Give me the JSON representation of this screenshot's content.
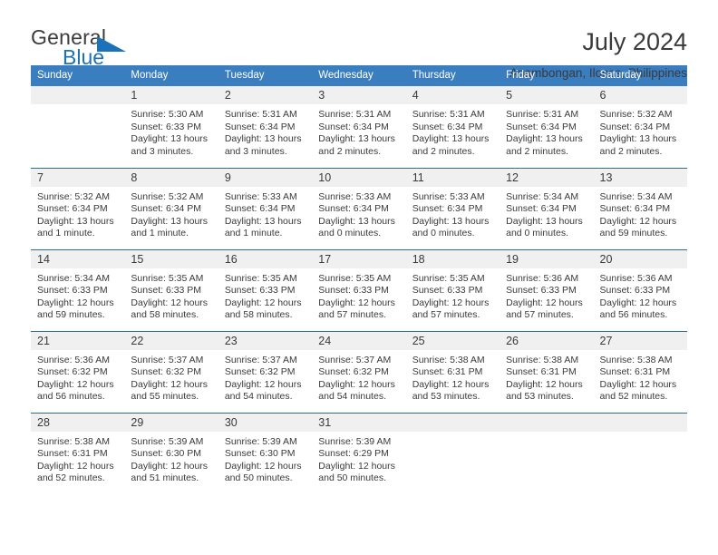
{
  "brand": {
    "name_top": "General",
    "name_bottom": "Blue",
    "triangle_color": "#1b72b8"
  },
  "header": {
    "title": "July 2024",
    "subtitle": "Anambongan, Ilocos, Philippines"
  },
  "theme": {
    "header_bg": "#3a7ec0",
    "row_divider": "#2e6da4",
    "daynum_bg": "#f0f0f0",
    "text": "#3a3a3a"
  },
  "weekdays": [
    "Sunday",
    "Monday",
    "Tuesday",
    "Wednesday",
    "Thursday",
    "Friday",
    "Saturday"
  ],
  "weeks": [
    [
      {
        "day": "",
        "sunrise": "",
        "sunset": "",
        "daylight": ""
      },
      {
        "day": "1",
        "sunrise": "Sunrise: 5:30 AM",
        "sunset": "Sunset: 6:33 PM",
        "daylight": "Daylight: 13 hours and 3 minutes."
      },
      {
        "day": "2",
        "sunrise": "Sunrise: 5:31 AM",
        "sunset": "Sunset: 6:34 PM",
        "daylight": "Daylight: 13 hours and 3 minutes."
      },
      {
        "day": "3",
        "sunrise": "Sunrise: 5:31 AM",
        "sunset": "Sunset: 6:34 PM",
        "daylight": "Daylight: 13 hours and 2 minutes."
      },
      {
        "day": "4",
        "sunrise": "Sunrise: 5:31 AM",
        "sunset": "Sunset: 6:34 PM",
        "daylight": "Daylight: 13 hours and 2 minutes."
      },
      {
        "day": "5",
        "sunrise": "Sunrise: 5:31 AM",
        "sunset": "Sunset: 6:34 PM",
        "daylight": "Daylight: 13 hours and 2 minutes."
      },
      {
        "day": "6",
        "sunrise": "Sunrise: 5:32 AM",
        "sunset": "Sunset: 6:34 PM",
        "daylight": "Daylight: 13 hours and 2 minutes."
      }
    ],
    [
      {
        "day": "7",
        "sunrise": "Sunrise: 5:32 AM",
        "sunset": "Sunset: 6:34 PM",
        "daylight": "Daylight: 13 hours and 1 minute."
      },
      {
        "day": "8",
        "sunrise": "Sunrise: 5:32 AM",
        "sunset": "Sunset: 6:34 PM",
        "daylight": "Daylight: 13 hours and 1 minute."
      },
      {
        "day": "9",
        "sunrise": "Sunrise: 5:33 AM",
        "sunset": "Sunset: 6:34 PM",
        "daylight": "Daylight: 13 hours and 1 minute."
      },
      {
        "day": "10",
        "sunrise": "Sunrise: 5:33 AM",
        "sunset": "Sunset: 6:34 PM",
        "daylight": "Daylight: 13 hours and 0 minutes."
      },
      {
        "day": "11",
        "sunrise": "Sunrise: 5:33 AM",
        "sunset": "Sunset: 6:34 PM",
        "daylight": "Daylight: 13 hours and 0 minutes."
      },
      {
        "day": "12",
        "sunrise": "Sunrise: 5:34 AM",
        "sunset": "Sunset: 6:34 PM",
        "daylight": "Daylight: 13 hours and 0 minutes."
      },
      {
        "day": "13",
        "sunrise": "Sunrise: 5:34 AM",
        "sunset": "Sunset: 6:34 PM",
        "daylight": "Daylight: 12 hours and 59 minutes."
      }
    ],
    [
      {
        "day": "14",
        "sunrise": "Sunrise: 5:34 AM",
        "sunset": "Sunset: 6:33 PM",
        "daylight": "Daylight: 12 hours and 59 minutes."
      },
      {
        "day": "15",
        "sunrise": "Sunrise: 5:35 AM",
        "sunset": "Sunset: 6:33 PM",
        "daylight": "Daylight: 12 hours and 58 minutes."
      },
      {
        "day": "16",
        "sunrise": "Sunrise: 5:35 AM",
        "sunset": "Sunset: 6:33 PM",
        "daylight": "Daylight: 12 hours and 58 minutes."
      },
      {
        "day": "17",
        "sunrise": "Sunrise: 5:35 AM",
        "sunset": "Sunset: 6:33 PM",
        "daylight": "Daylight: 12 hours and 57 minutes."
      },
      {
        "day": "18",
        "sunrise": "Sunrise: 5:35 AM",
        "sunset": "Sunset: 6:33 PM",
        "daylight": "Daylight: 12 hours and 57 minutes."
      },
      {
        "day": "19",
        "sunrise": "Sunrise: 5:36 AM",
        "sunset": "Sunset: 6:33 PM",
        "daylight": "Daylight: 12 hours and 57 minutes."
      },
      {
        "day": "20",
        "sunrise": "Sunrise: 5:36 AM",
        "sunset": "Sunset: 6:33 PM",
        "daylight": "Daylight: 12 hours and 56 minutes."
      }
    ],
    [
      {
        "day": "21",
        "sunrise": "Sunrise: 5:36 AM",
        "sunset": "Sunset: 6:32 PM",
        "daylight": "Daylight: 12 hours and 56 minutes."
      },
      {
        "day": "22",
        "sunrise": "Sunrise: 5:37 AM",
        "sunset": "Sunset: 6:32 PM",
        "daylight": "Daylight: 12 hours and 55 minutes."
      },
      {
        "day": "23",
        "sunrise": "Sunrise: 5:37 AM",
        "sunset": "Sunset: 6:32 PM",
        "daylight": "Daylight: 12 hours and 54 minutes."
      },
      {
        "day": "24",
        "sunrise": "Sunrise: 5:37 AM",
        "sunset": "Sunset: 6:32 PM",
        "daylight": "Daylight: 12 hours and 54 minutes."
      },
      {
        "day": "25",
        "sunrise": "Sunrise: 5:38 AM",
        "sunset": "Sunset: 6:31 PM",
        "daylight": "Daylight: 12 hours and 53 minutes."
      },
      {
        "day": "26",
        "sunrise": "Sunrise: 5:38 AM",
        "sunset": "Sunset: 6:31 PM",
        "daylight": "Daylight: 12 hours and 53 minutes."
      },
      {
        "day": "27",
        "sunrise": "Sunrise: 5:38 AM",
        "sunset": "Sunset: 6:31 PM",
        "daylight": "Daylight: 12 hours and 52 minutes."
      }
    ],
    [
      {
        "day": "28",
        "sunrise": "Sunrise: 5:38 AM",
        "sunset": "Sunset: 6:31 PM",
        "daylight": "Daylight: 12 hours and 52 minutes."
      },
      {
        "day": "29",
        "sunrise": "Sunrise: 5:39 AM",
        "sunset": "Sunset: 6:30 PM",
        "daylight": "Daylight: 12 hours and 51 minutes."
      },
      {
        "day": "30",
        "sunrise": "Sunrise: 5:39 AM",
        "sunset": "Sunset: 6:30 PM",
        "daylight": "Daylight: 12 hours and 50 minutes."
      },
      {
        "day": "31",
        "sunrise": "Sunrise: 5:39 AM",
        "sunset": "Sunset: 6:29 PM",
        "daylight": "Daylight: 12 hours and 50 minutes."
      },
      {
        "day": "",
        "sunrise": "",
        "sunset": "",
        "daylight": ""
      },
      {
        "day": "",
        "sunrise": "",
        "sunset": "",
        "daylight": ""
      },
      {
        "day": "",
        "sunrise": "",
        "sunset": "",
        "daylight": ""
      }
    ]
  ]
}
